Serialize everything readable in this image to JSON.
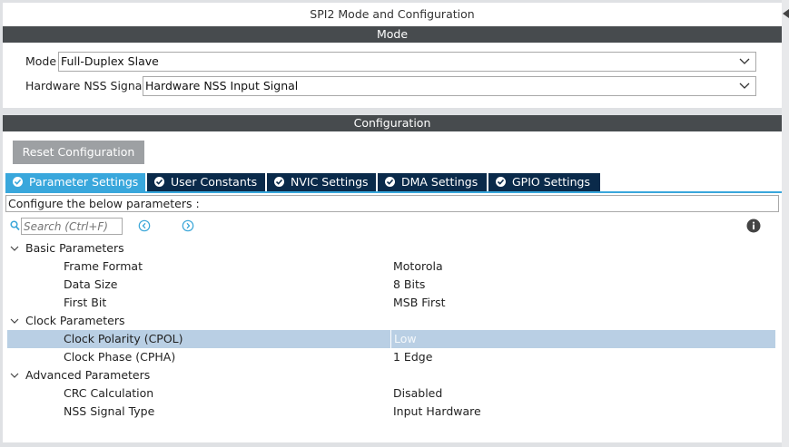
{
  "window": {
    "title": "SPI2 Mode and Configuration"
  },
  "mode": {
    "header": "Mode",
    "fields": [
      {
        "label": "Mode",
        "value": "Full-Duplex Slave"
      },
      {
        "label": "Hardware NSS Signal",
        "value": "Hardware NSS Input Signal"
      }
    ]
  },
  "configuration": {
    "header": "Configuration",
    "reset_label": "Reset Configuration",
    "tabs": [
      {
        "label": "Parameter Settings",
        "active": true
      },
      {
        "label": "User Constants",
        "active": false
      },
      {
        "label": "NVIC Settings",
        "active": false
      },
      {
        "label": "DMA Settings",
        "active": false
      },
      {
        "label": "GPIO Settings",
        "active": false
      }
    ],
    "instruction": "Configure the below parameters :",
    "search_placeholder": "Search (Ctrl+F)",
    "groups": [
      {
        "label": "Basic Parameters",
        "params": [
          {
            "name": "Frame Format",
            "value": "Motorola"
          },
          {
            "name": "Data Size",
            "value": "8 Bits"
          },
          {
            "name": "First Bit",
            "value": "MSB First"
          }
        ]
      },
      {
        "label": "Clock Parameters",
        "params": [
          {
            "name": "Clock Polarity (CPOL)",
            "value": "Low",
            "selected": true
          },
          {
            "name": "Clock Phase (CPHA)",
            "value": "1 Edge"
          }
        ]
      },
      {
        "label": "Advanced Parameters",
        "params": [
          {
            "name": "CRC Calculation",
            "value": "Disabled"
          },
          {
            "name": "NSS Signal Type",
            "value": "Input Hardware"
          }
        ]
      }
    ]
  },
  "colors": {
    "header_bg": "#474b4e",
    "tab_active": "#39a7dc",
    "tab_inactive": "#0a2a4a",
    "row_selected": "#b9cfe4",
    "nav_accent": "#3aa6d8"
  },
  "icons": {
    "search": "search-icon",
    "prev": "chevron-left-circle-icon",
    "next": "chevron-right-circle-icon",
    "info": "info-icon",
    "dropdown": "chevron-down-icon",
    "expand": "caret-down-icon",
    "tab_check": "check-circle-icon"
  }
}
